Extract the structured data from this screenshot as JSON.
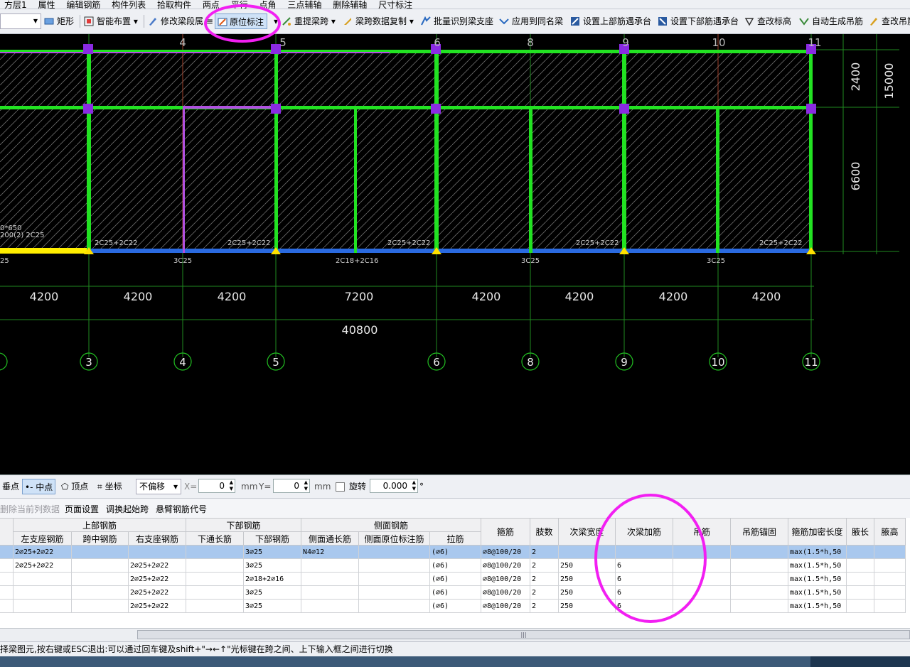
{
  "toolbar_top": [
    "方层1",
    "属性",
    "编辑钢筋",
    "构件列表",
    "拾取构件",
    "两点",
    "平行",
    "点角",
    "三点辅轴",
    "删除辅轴",
    "尺寸标注"
  ],
  "toolbar": {
    "rect": "矩形",
    "smart": "智能布置",
    "modify_span": "修改梁段属",
    "in_situ": "原位标注",
    "reextract": "重提梁跨",
    "copy_span": "梁跨数据复制",
    "batch_support": "批量识别梁支座",
    "apply_same": "应用到同名梁",
    "set_top_cap": "设置上部筋遇承台",
    "set_bottom_cap": "设置下部筋遇承台",
    "check_elev": "查改标高",
    "auto_hanger": "自动生成吊筋",
    "check_more": "查改吊筋"
  },
  "canvas": {
    "top_axis_labels": [
      "4",
      "5",
      "6",
      "8",
      "9",
      "10",
      "11"
    ],
    "bottom_axis_labels": [
      "3",
      "4",
      "5",
      "6",
      "8",
      "9",
      "10",
      "11"
    ],
    "span_dims": [
      "4200",
      "4200",
      "4200",
      "7200",
      "4200",
      "4200",
      "4200",
      "4200"
    ],
    "total_dim": "40800",
    "right_dims": [
      "2400",
      "6600",
      "15000"
    ],
    "beam_top_labels": [
      "2C25+2C22",
      "2C25+2C22",
      "2C25+2C22",
      "2C25+2C22",
      "2C25+2C22"
    ],
    "beam_bottom_labels": [
      "25",
      "3C25",
      "2C18+2C16",
      "3C25",
      "3C25"
    ],
    "left_annotation_1": "0*650",
    "left_annotation_2": "200(2) 2C25"
  },
  "snapbar": {
    "perp": "垂点",
    "mid": "中点",
    "vertex": "顶点",
    "coord": "坐标",
    "offset": "不偏移",
    "x_label": "X=",
    "x_value": "0",
    "y_label": "Y=",
    "y_value": "0",
    "unit": "mm",
    "rotate": "旋转",
    "rotate_value": "0.000",
    "deg": "°"
  },
  "actions": {
    "delete_col": "删除当前列数据",
    "page_setup": "页面设置",
    "swap_start": "调换起始跨",
    "cantilever": "悬臂钢筋代号"
  },
  "table": {
    "group_headers": [
      "上部钢筋",
      "下部钢筋",
      "侧面钢筋"
    ],
    "sub_headers": [
      "左支座钢筋",
      "跨中钢筋",
      "右支座钢筋",
      "下通长筋",
      "下部钢筋",
      "侧面通长筋",
      "侧面原位标注筋",
      "拉筋"
    ],
    "single_headers": [
      "箍筋",
      "肢数",
      "次梁宽度",
      "次梁加筋",
      "吊筋",
      "吊筋锚固",
      "箍筋加密长度",
      "腋长",
      "腋高"
    ],
    "rows": [
      [
        "2⌀25+2⌀22",
        "",
        "",
        "",
        "3⌀25",
        "N4⌀12",
        "",
        "(⌀6)",
        "⌀8@100/20",
        "2",
        "",
        "",
        "",
        "",
        "max(1.5*h,50",
        "",
        ""
      ],
      [
        "2⌀25+2⌀22",
        "",
        "2⌀25+2⌀22",
        "",
        "3⌀25",
        "",
        "",
        "(⌀6)",
        "⌀8@100/20",
        "2",
        "250",
        "6",
        "",
        "",
        "max(1.5*h,50",
        "",
        ""
      ],
      [
        "",
        "",
        "2⌀25+2⌀22",
        "",
        "2⌀18+2⌀16",
        "",
        "",
        "(⌀6)",
        "⌀8@100/20",
        "2",
        "250",
        "6",
        "",
        "",
        "max(1.5*h,50",
        "",
        ""
      ],
      [
        "",
        "",
        "2⌀25+2⌀22",
        "",
        "3⌀25",
        "",
        "",
        "(⌀6)",
        "⌀8@100/20",
        "2",
        "250",
        "6",
        "",
        "",
        "max(1.5*h,50",
        "",
        ""
      ],
      [
        "",
        "",
        "2⌀25+2⌀22",
        "",
        "3⌀25",
        "",
        "",
        "(⌀6)",
        "⌀8@100/20",
        "2",
        "250",
        "6",
        "",
        "",
        "max(1.5*h,50",
        "",
        ""
      ]
    ]
  },
  "status_text": "择梁图元,按右键或ESC退出:可以通过回车键及shift+\"→←↑\"光标键在跨之间、上下输入框之间进行切换"
}
